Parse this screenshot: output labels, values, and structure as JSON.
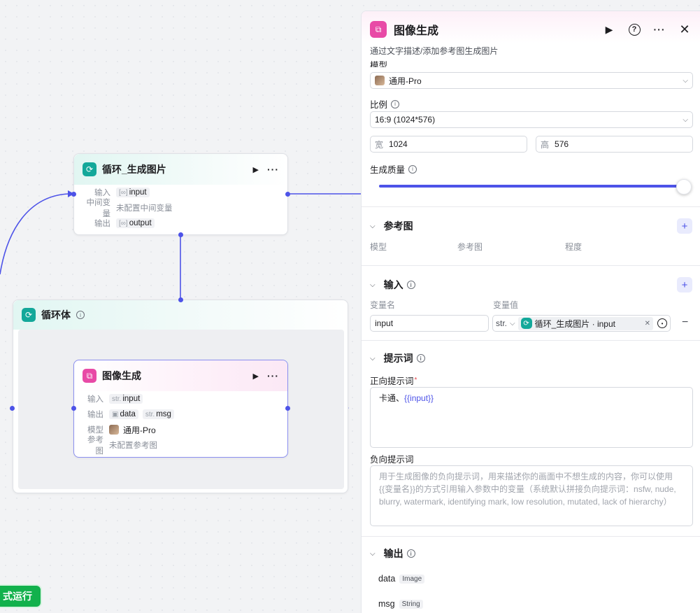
{
  "canvas": {
    "loop_node": {
      "title": "循环_生成图片",
      "input_label": "输入",
      "input_value": "input",
      "mid_var_label": "中间变量",
      "mid_var_value": "未配置中间变量",
      "output_label": "输出",
      "output_value": "output"
    },
    "loop_body": {
      "title": "循环体"
    },
    "image_node": {
      "title": "图像生成",
      "input_label": "输入",
      "input_prefix": "str.",
      "input_value": "input",
      "output_label": "输出",
      "output_data": "data",
      "output_msg_prefix": "str.",
      "output_msg": "msg",
      "model_label": "模型",
      "model_value": "通用-Pro",
      "ref_label": "参考图",
      "ref_value": "未配置参考图"
    },
    "test_run_label": "式运行"
  },
  "panel": {
    "title": "图像生成",
    "description": "通过文字描述/添加参考图生成图片",
    "model_label": "模型",
    "model_value": "通用-Pro",
    "ratio_label": "比例",
    "ratio_value": "16:9 (1024*576)",
    "width_label": "宽",
    "width_value": "1024",
    "height_label": "高",
    "height_value": "576",
    "quality_label": "生成质量",
    "quality_level": 1.0,
    "reference": {
      "title": "参考图",
      "col_model": "模型",
      "col_image": "参考图",
      "col_degree": "程度"
    },
    "input": {
      "title": "输入",
      "col_name": "变量名",
      "col_value": "变量值",
      "var_name": "input",
      "var_type": "str.",
      "var_ref": "循环_生成图片 · input"
    },
    "prompt": {
      "title": "提示词",
      "positive_label": "正向提示词",
      "positive_text": "卡通、",
      "positive_var": "{{input}}",
      "negative_label": "负向提示词",
      "negative_placeholder": "用于生成图像的负向提示词，用来描述你的画面中不想生成的内容，你可以使用{{变量名}}的方式引用输入参数中的变量（系统默认拼接负向提示词：nsfw, nude, blurry, watermark, identifying mark, low resolution, mutated, lack of hierarchy）"
    },
    "output": {
      "title": "输出",
      "items": [
        {
          "name": "data",
          "type": "Image"
        },
        {
          "name": "msg",
          "type": "String"
        }
      ]
    }
  },
  "colors": {
    "accent": "#4d53e8",
    "teal": "#13a89a",
    "pink": "#e84aa6",
    "run_green": "#12b14c"
  }
}
